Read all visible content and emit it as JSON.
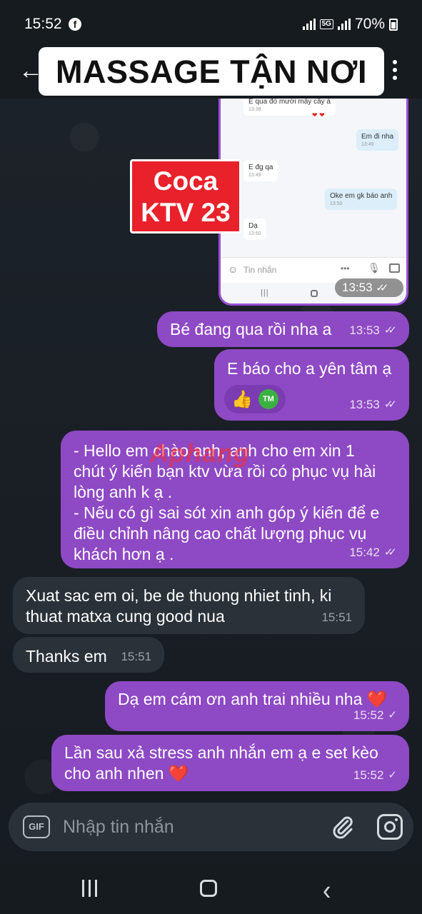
{
  "status_bar": {
    "time": "15:52",
    "battery": "70%",
    "network_badge": "5G"
  },
  "header": {
    "title": "MASSAGE TẬN NƠI"
  },
  "embedded_screenshot": {
    "messages": [
      {
        "text": "E qua đó mười mấy cây á",
        "time": "13:38"
      },
      {
        "text": "Em đi nha",
        "time": "13:49"
      },
      {
        "text": "E đg qa",
        "time": "13:49"
      },
      {
        "text": "Oke em gk báo anh",
        "time": "13:50"
      },
      {
        "text": "Dạ",
        "time": "13:50"
      }
    ],
    "input_placeholder": "Tin nhắn",
    "timestamp": "13:53"
  },
  "sticker": {
    "line1": "Coca",
    "line2": "KTV 23"
  },
  "watermark": "Aphang",
  "messages": [
    {
      "text": "Bé đang qua rồi nha a",
      "time": "13:53",
      "ticks": "✓✓"
    },
    {
      "text": "E báo cho a yên tâm ạ",
      "time": "13:53",
      "ticks": "✓✓",
      "reactions": [
        "👍",
        "TM"
      ]
    },
    {
      "text_lines": [
        "- Hello em chào anh, anh cho em xin 1",
        "chút ý kiến bạn ktv vừa rồi có phục vụ hài",
        "lòng anh k ạ .",
        "- Nếu có gì sai sót xin anh góp ý kiến để e",
        "điều chỉnh nâng cao chất lượng phục vụ",
        "khách hơn ạ ."
      ],
      "time": "15:42",
      "ticks": "✓✓"
    },
    {
      "text_lines": [
        "Xuat sac em oi, be de thuong nhiet tinh, ki",
        "thuat matxa cung good nua"
      ],
      "time": "15:51"
    },
    {
      "text": "Thanks em",
      "time": "15:51"
    },
    {
      "text": "Dạ em cám ơn anh trai nhiều nha",
      "emoji": "❤️",
      "time": "15:52",
      "ticks": "✓"
    },
    {
      "text_lines": [
        "Lần sau xả stress anh nhắn em ạ e set kèo",
        "cho anh nhen"
      ],
      "emoji": "❤️",
      "time": "15:52",
      "ticks": "✓"
    }
  ],
  "composer": {
    "gif_label": "GIF",
    "placeholder": "Nhập tin nhắn"
  },
  "colors": {
    "outgoing_bubble": "#8e49c5",
    "incoming_bubble": "#2a3139",
    "background": "#1b2128"
  }
}
